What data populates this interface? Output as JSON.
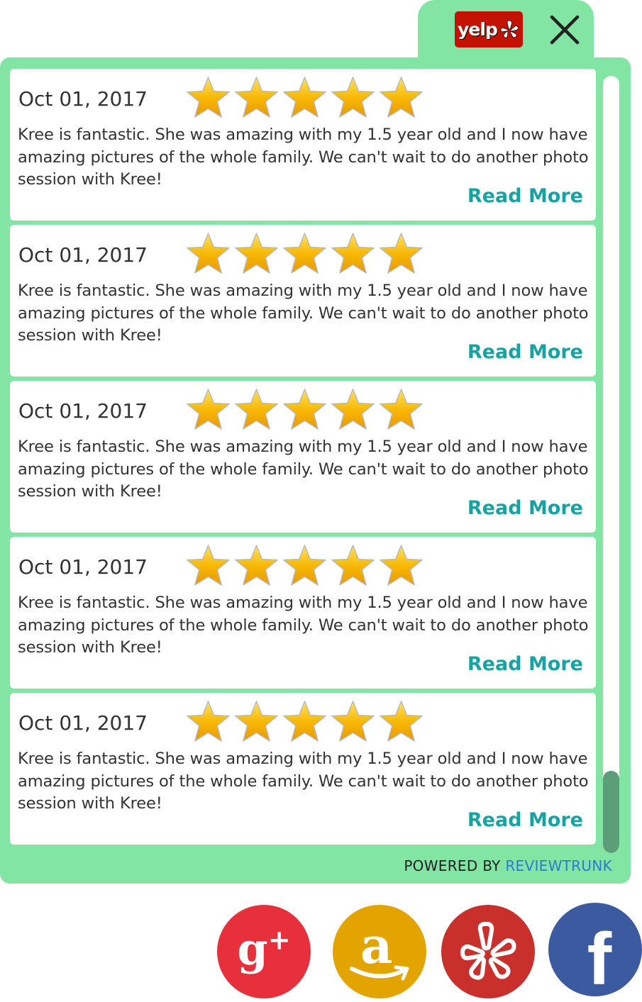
{
  "header": {
    "yelp_logo_text": "yelp",
    "close_icon": "close-icon"
  },
  "reviews": [
    {
      "date": "Oct 01, 2017",
      "rating": 5,
      "text": "Kree is fantastic. She was amazing with my 1.5 year old and I now have amazing pictures of the whole family. We can't wait to do another photo session with Kree!",
      "read_more": "Read More"
    },
    {
      "date": "Oct 01, 2017",
      "rating": 5,
      "text": "Kree is fantastic. She was amazing with my 1.5 year old and I now have amazing pictures of the whole family. We can't wait to do another photo session with Kree!",
      "read_more": "Read More"
    },
    {
      "date": "Oct 01, 2017",
      "rating": 5,
      "text": "Kree is fantastic. She was amazing with my 1.5 year old and I now have amazing pictures of the whole family. We can't wait to do another photo session with Kree!",
      "read_more": "Read More"
    },
    {
      "date": "Oct 01, 2017",
      "rating": 5,
      "text": "Kree is fantastic. She was amazing with my 1.5 year old and I now have amazing pictures of the whole family. We can't wait to do another photo session with Kree!",
      "read_more": "Read More"
    },
    {
      "date": "Oct 01, 2017",
      "rating": 5,
      "text": "Kree is fantastic. She was amazing with my 1.5 year old and I now have amazing pictures of the whole family. We can't wait to do another photo session with Kree!",
      "read_more": "Read More"
    }
  ],
  "footer": {
    "powered_by": "POWERED BY",
    "brand": "REVIEWTRUNK"
  },
  "social": [
    {
      "name": "google-plus",
      "icon": "google-plus-icon",
      "glyph": "g",
      "sup": "+",
      "color": "#e8303c"
    },
    {
      "name": "amazon",
      "icon": "amazon-icon",
      "glyph": "a",
      "color": "#e3a400"
    },
    {
      "name": "yelp",
      "icon": "yelp-icon",
      "color": "#c9302c"
    },
    {
      "name": "facebook",
      "icon": "facebook-icon",
      "glyph": "f",
      "color": "#3b5a9f"
    }
  ],
  "colors": {
    "panel": "#82e5a4",
    "accent": "#17a3a3",
    "star": "#f7b500",
    "yelp_red": "#c41200"
  }
}
